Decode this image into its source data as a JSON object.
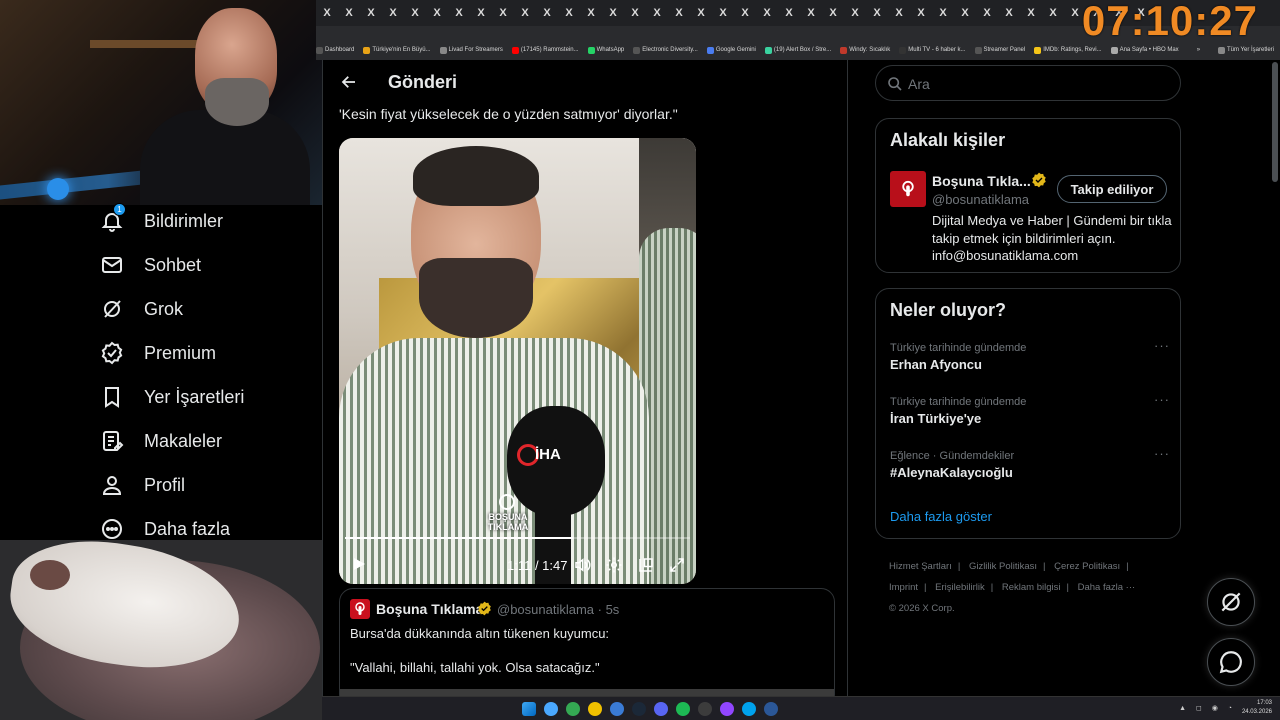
{
  "clock": "07:10:27",
  "tabs": {
    "tab_glyph": "X"
  },
  "bookmarks": [
    {
      "label": "Dashboard",
      "color": "#555"
    },
    {
      "label": "Türkiye'nin En Büyü...",
      "color": "#e8a317"
    },
    {
      "label": "Livad For Streamers",
      "color": "#888"
    },
    {
      "label": "(17145) Rammstein...",
      "color": "#ff0000"
    },
    {
      "label": "WhatsApp",
      "color": "#25d366"
    },
    {
      "label": "Electronic Diversity...",
      "color": "#555"
    },
    {
      "label": "Google Gemini",
      "color": "#4a7cf0"
    },
    {
      "label": "(19) Alert Box / Stre...",
      "color": "#3ad29f"
    },
    {
      "label": "Windy: Sıcaklık",
      "color": "#c0392b"
    },
    {
      "label": "Multi TV - 6 haber k...",
      "color": "#333"
    },
    {
      "label": "Streamer Panel",
      "color": "#555"
    },
    {
      "label": "IMDb: Ratings, Revi...",
      "color": "#f5c518"
    },
    {
      "label": "Ana Sayfa • HBO Max",
      "color": "#aaa"
    },
    {
      "label": "»",
      "color": "transparent"
    },
    {
      "label": "Tüm Yer İşaretleri",
      "color": "#888"
    }
  ],
  "nav": {
    "notifications_badge": "1",
    "items": [
      {
        "label": "Bildirimler",
        "icon": "bell-icon"
      },
      {
        "label": "Sohbet",
        "icon": "mail-icon"
      },
      {
        "label": "Grok",
        "icon": "grok-icon"
      },
      {
        "label": "Premium",
        "icon": "verified-icon"
      },
      {
        "label": "Yer İşaretleri",
        "icon": "bookmark-icon"
      },
      {
        "label": "Makaleler",
        "icon": "article-icon"
      },
      {
        "label": "Profil",
        "icon": "person-icon"
      },
      {
        "label": "Daha fazla",
        "icon": "more-circle-icon"
      }
    ]
  },
  "post": {
    "header_title": "Gönderi",
    "text": "'Kesin fiyat yükselecek de o yüzden satmıyor' diyorlar.\"",
    "video": {
      "time": "1:11 / 1:47",
      "progress": 0.66,
      "mic_label": "İHA",
      "watermark": "BOŞUNA TIKLAMA"
    },
    "quoted": {
      "name": "Boşuna Tıklama",
      "handle_time": "@bosunatiklama · 5s",
      "line1": "Bursa'da dükkanında altın tükenen kuyumcu:",
      "line2": "\"Vallahi, billahi, tallahi yok. Olsa satacağız.\""
    }
  },
  "search": {
    "placeholder": "Ara"
  },
  "related": {
    "title": "Alakalı kişiler",
    "name": "Boşuna Tıkla...",
    "handle": "@bosunatiklama",
    "follow_label": "Takip ediliyor",
    "bio": "Dijital Medya ve Haber | Gündemi bir tıkla takip etmek için bildirimleri açın. info@bosunatiklama.com"
  },
  "trends": {
    "title": "Neler oluyor?",
    "items": [
      {
        "meta": "Türkiye tarihinde gündemde",
        "title": "Erhan Afyoncu"
      },
      {
        "meta": "Türkiye tarihinde gündemde",
        "title": "İran Türkiye'ye"
      },
      {
        "meta": "Eğlence · Gündemdekiler",
        "title": "#AleynaKalaycıoğlu"
      }
    ],
    "show_more": "Daha fazla göster"
  },
  "footer": {
    "links": [
      "Hizmet Şartları",
      "Gizlilik Politikası",
      "Çerez Politikası",
      "Imprint",
      "Erişilebilirlik",
      "Reklam bilgisi",
      "Daha fazla ···"
    ],
    "copyright": "© 2026 X Corp."
  },
  "taskbar": {
    "time": "17:03",
    "date": "24.03.2026",
    "app_colors": [
      "#4aa8ff",
      "#34a853",
      "#f0c000",
      "#3a7bd5",
      "#1b2838",
      "#5865f2",
      "#1db954",
      "#3c3c3c",
      "#9146ff",
      "#00a2ed",
      "#2b5797"
    ]
  },
  "colors": {
    "accent": "#1d9bf0",
    "verified_gold": "#e2b719",
    "clock_orange": "#f08a24"
  }
}
